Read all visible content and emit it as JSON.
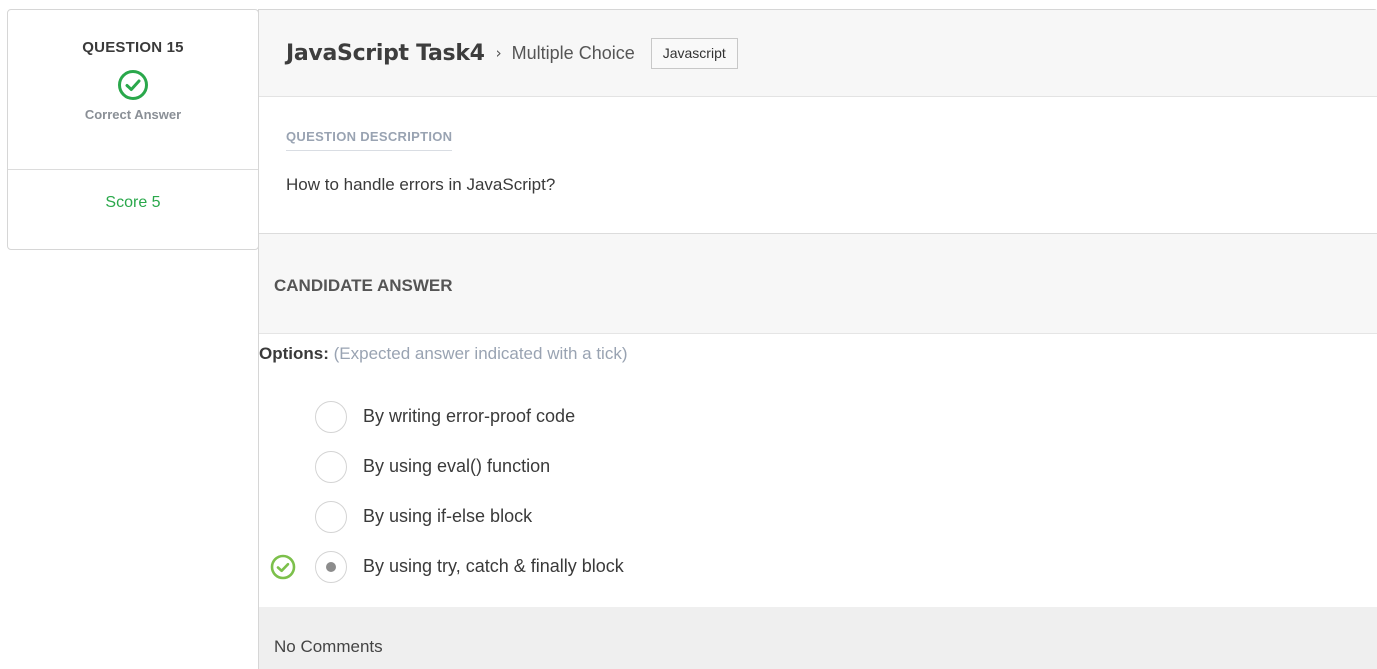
{
  "summary": {
    "question_label": "QUESTION 15",
    "status": "Correct Answer",
    "score": "Score 5",
    "status_color": "#2aa84b"
  },
  "header": {
    "title": "JavaScript Task4",
    "separator": "›",
    "question_type": "Multiple Choice",
    "tag": "Javascript"
  },
  "description": {
    "heading": "QUESTION DESCRIPTION",
    "text": "How to handle errors in JavaScript?"
  },
  "candidate": {
    "heading": "CANDIDATE ANSWER",
    "options_label": "Options:",
    "options_hint": "(Expected answer indicated with a tick)",
    "options": [
      {
        "text": "By writing error-proof code",
        "selected": false,
        "expected": false
      },
      {
        "text": "By using eval() function",
        "selected": false,
        "expected": false
      },
      {
        "text": "By using if-else block",
        "selected": false,
        "expected": false
      },
      {
        "text": "By using try, catch & finally block",
        "selected": true,
        "expected": true
      }
    ]
  },
  "comments": {
    "text": "No Comments"
  },
  "icons": {
    "status": "check-circle-icon",
    "expected_tick": "check-circle-icon",
    "tick_color": "#7cc04b"
  }
}
